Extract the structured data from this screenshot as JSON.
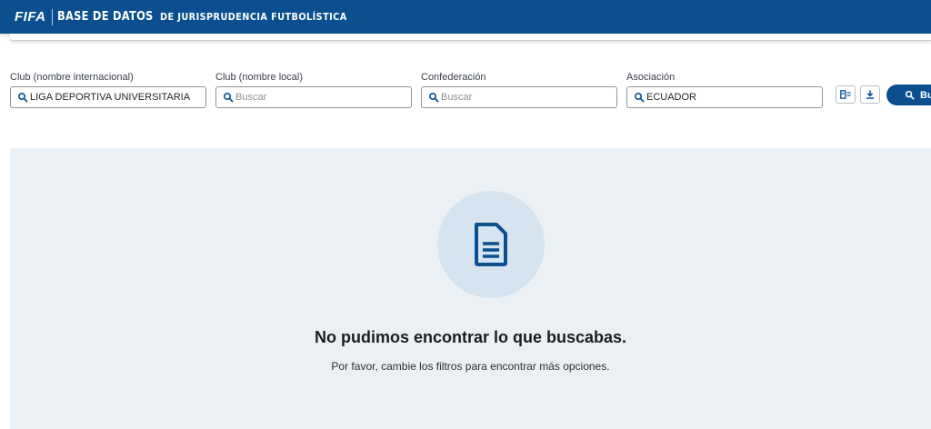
{
  "header": {
    "logo": "FIFA",
    "title": "BASE DE DATOS",
    "subtitle": "DE JURISPRUDENCIA FUTBOLÍSTICA",
    "color": "#0b4f8f"
  },
  "filters": [
    {
      "label": "Club (nombre internacional)",
      "value": "LIGA DEPORTIVA UNIVERSITARIA",
      "placeholder": "Buscar"
    },
    {
      "label": "Club (nombre local)",
      "value": "",
      "placeholder": "Buscar"
    },
    {
      "label": "Confederación",
      "value": "",
      "placeholder": "Buscar"
    },
    {
      "label": "Asociación",
      "value": "ECUADOR",
      "placeholder": "Buscar"
    }
  ],
  "actions": {
    "columns_icon": "table-columns-icon",
    "download_icon": "download-icon",
    "search_label": "Bu"
  },
  "empty_state": {
    "icon": "document-icon",
    "title": "No pudimos encontrar lo que buscabas.",
    "message": "Por favor, cambie los filtros para encontrar más opciones."
  }
}
